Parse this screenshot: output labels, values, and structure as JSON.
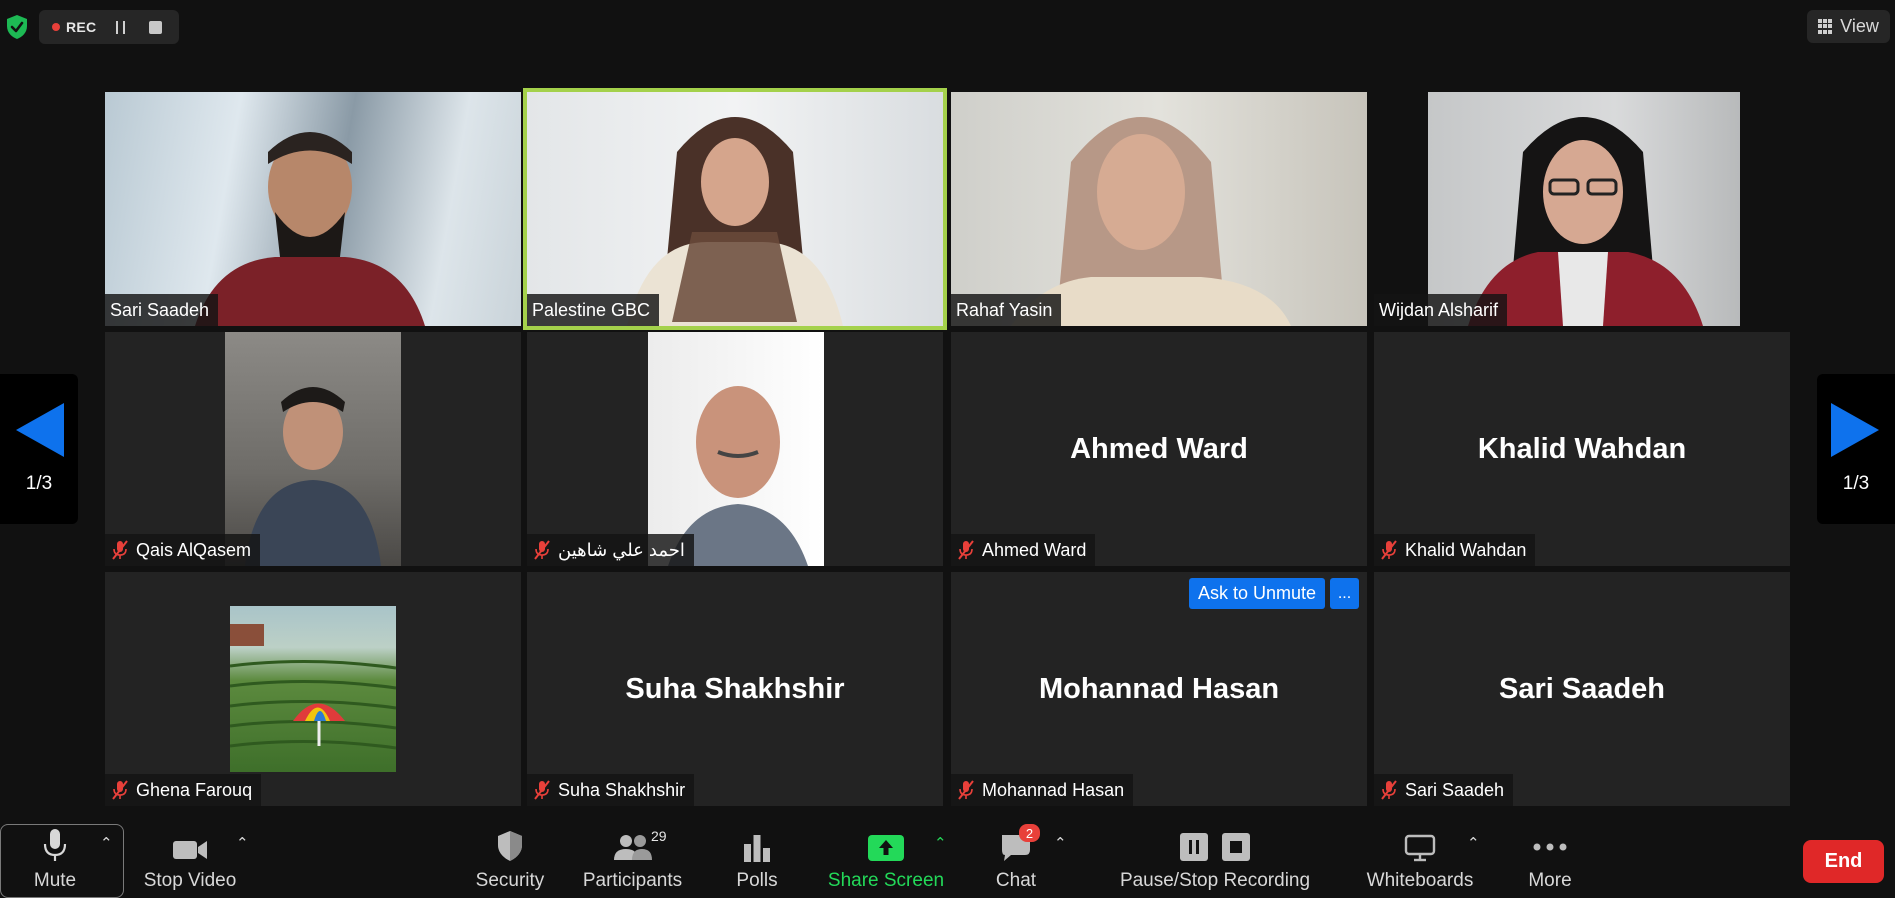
{
  "top_bar": {
    "rec_label": "REC",
    "view_label": "View"
  },
  "page_indicator": {
    "current": "1/3"
  },
  "tiles": [
    {
      "name": "Sari Saadeh",
      "muted": false,
      "has_video": true,
      "active_speaker": false
    },
    {
      "name": "Palestine GBC",
      "muted": false,
      "has_video": true,
      "active_speaker": true
    },
    {
      "name": "Rahaf Yasin",
      "muted": false,
      "has_video": true,
      "active_speaker": false
    },
    {
      "name": "Wijdan Alsharif",
      "muted": false,
      "has_video": true,
      "active_speaker": false
    },
    {
      "name": "Qais AlQasem",
      "muted": true,
      "has_video": true,
      "active_speaker": false
    },
    {
      "name": "احمد علي شاهين",
      "muted": true,
      "has_video": true,
      "active_speaker": false
    },
    {
      "name": "Ahmed Ward",
      "muted": true,
      "has_video": false,
      "active_speaker": false
    },
    {
      "name": "Khalid Wahdan",
      "muted": true,
      "has_video": false,
      "active_speaker": false
    },
    {
      "name": "Ghena Farouq",
      "muted": true,
      "has_video": false,
      "active_speaker": false
    },
    {
      "name": "Suha Shakhshir",
      "muted": true,
      "has_video": false,
      "active_speaker": false
    },
    {
      "name": "Mohannad Hasan",
      "muted": true,
      "has_video": false,
      "active_speaker": false,
      "ask_to_unmute_label": "Ask to Unmute",
      "more_label": "..."
    },
    {
      "name": "Sari Saadeh",
      "muted": true,
      "has_video": false,
      "active_speaker": false
    }
  ],
  "toolbar": {
    "mute_label": "Mute",
    "stop_video_label": "Stop Video",
    "security_label": "Security",
    "participants_label": "Participants",
    "participants_count": "29",
    "polls_label": "Polls",
    "share_screen_label": "Share Screen",
    "chat_label": "Chat",
    "chat_unread": "2",
    "recording_label": "Pause/Stop Recording",
    "whiteboards_label": "Whiteboards",
    "more_label": "More",
    "end_label": "End"
  },
  "colors": {
    "background": "#111111",
    "tile_bg": "#232323",
    "active_speaker_border": "#a4d14b",
    "share_screen_green": "#23d959",
    "end_red": "#e02828",
    "accent_blue": "#0e72ed",
    "muted_red": "#e8403a"
  }
}
